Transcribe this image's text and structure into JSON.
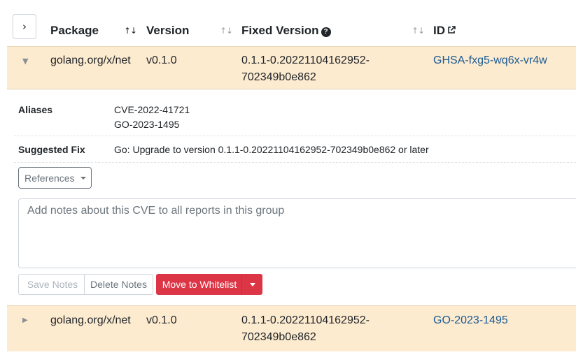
{
  "toolbar": {
    "expand_glyph": "›"
  },
  "table": {
    "headers": {
      "package": "Package",
      "version": "Version",
      "fixed_version": "Fixed Version",
      "id": "ID"
    },
    "sort_glyph": "↑↓",
    "help_glyph": "?"
  },
  "rows": [
    {
      "caret": "▼",
      "package": "golang.org/x/net",
      "version": "v0.1.0",
      "fixed_line1": "0.1.1-0.20221104162952-",
      "fixed_line2": "702349b0e862",
      "id": "GHSA-fxg5-wq6x-vr4w"
    },
    {
      "caret": "▶",
      "package": "golang.org/x/net",
      "version": "v0.1.0",
      "fixed_line1": "0.1.1-0.20221104162952-",
      "fixed_line2": "702349b0e862",
      "id": "GO-2023-1495"
    }
  ],
  "detail": {
    "aliases_label": "Aliases",
    "aliases": [
      "CVE-2022-41721",
      "GO-2023-1495"
    ],
    "suggested_fix_label": "Suggested Fix",
    "suggested_fix": "Go: Upgrade to version 0.1.1-0.20221104162952-702349b0e862 or later",
    "references_label": "References",
    "notes_placeholder": "Add notes about this CVE to all reports in this group",
    "save_label": "Save Notes",
    "delete_label": "Delete Notes",
    "whitelist_label": "Move to Whitelist"
  },
  "colors": {
    "row_highlight": "#fdebd0",
    "link": "#1a5a92",
    "danger": "#dc3545"
  },
  "icons": [
    "chevron-right-icon",
    "sort-icon",
    "help-circle-icon",
    "external-link-icon",
    "caret-down-icon",
    "caret-right-icon"
  ]
}
